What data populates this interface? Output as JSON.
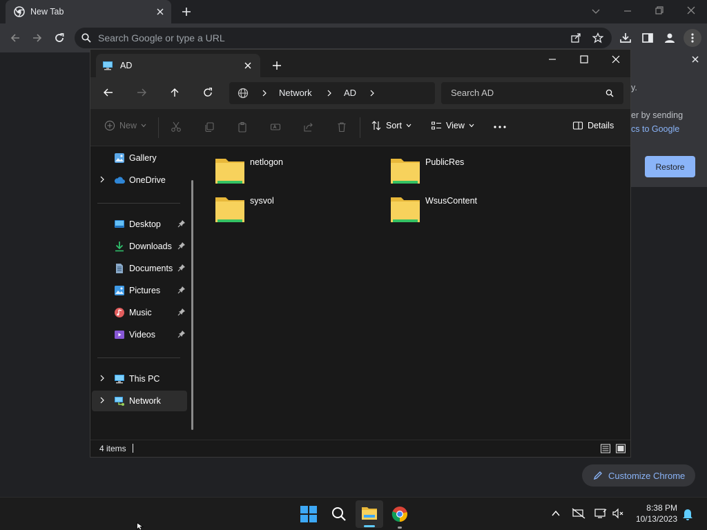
{
  "chrome": {
    "tab_title": "New Tab",
    "omnibox_placeholder": "Search Google or type a URL",
    "notice_fragment_1": "y.",
    "notice_fragment_2": "er by sending",
    "notice_fragment_3": "cs to Google",
    "restore_label": "Restore",
    "customize_label": "Customize Chrome"
  },
  "explorer": {
    "tab_title": "AD",
    "breadcrumb": [
      "Network",
      "AD"
    ],
    "search_placeholder": "Search AD",
    "toolbar": {
      "new_label": "New",
      "sort_label": "Sort",
      "view_label": "View",
      "details_label": "Details"
    },
    "nav_pane": {
      "gallery": "Gallery",
      "onedrive": "OneDrive",
      "desktop": "Desktop",
      "downloads": "Downloads",
      "documents": "Documents",
      "pictures": "Pictures",
      "music": "Music",
      "videos": "Videos",
      "this_pc": "This PC",
      "network": "Network"
    },
    "folders": [
      "netlogon",
      "PublicRes",
      "sysvol",
      "WsusContent"
    ],
    "status_items": "4 items"
  },
  "taskbar": {
    "time": "8:38 PM",
    "date": "10/13/2023"
  },
  "colors": {
    "accent": "#8ab4f8",
    "folder_yellow": "#f7d25c",
    "network_selected": "#2d2d2d"
  }
}
